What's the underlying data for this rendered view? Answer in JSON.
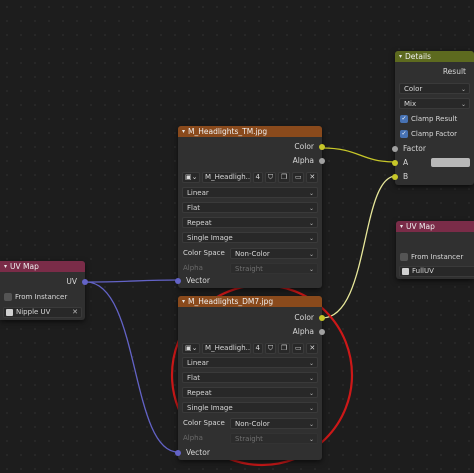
{
  "nodes": {
    "details": {
      "title": "Details",
      "out_result": "Result",
      "dd_color": "Color",
      "dd_mix": "Mix",
      "clamp_result": "Clamp Result",
      "clamp_factor": "Clamp Factor",
      "in_factor": "Factor",
      "in_a": "A",
      "in_b": "B"
    },
    "image_tm": {
      "title": "M_Headlights_TM.jpg",
      "out_color": "Color",
      "out_alpha": "Alpha",
      "image_name": "M_Headligh...",
      "users": "4",
      "interpolation": "Linear",
      "projection": "Flat",
      "extension": "Repeat",
      "source": "Single Image",
      "color_space_label": "Color Space",
      "color_space": "Non-Color",
      "alpha_label": "Alpha",
      "alpha": "Straight",
      "in_vector": "Vector"
    },
    "image_dm7": {
      "title": "M_Headlights_DM7.jpg",
      "out_color": "Color",
      "out_alpha": "Alpha",
      "image_name": "M_Headligh...",
      "users": "4",
      "interpolation": "Linear",
      "projection": "Flat",
      "extension": "Repeat",
      "source": "Single Image",
      "color_space_label": "Color Space",
      "color_space": "Non-Color",
      "alpha_label": "Alpha",
      "alpha": "Straight",
      "in_vector": "Vector"
    },
    "uvmap_left": {
      "title": "UV Map",
      "out_uv": "UV",
      "from_instancer": "From Instancer",
      "uv_name": "Nipple UV"
    },
    "uvmap_right": {
      "title": "UV Map",
      "from_instancer": "From Instancer",
      "uv_name": "FullUV"
    }
  },
  "colors": {
    "annotation_circle": "#cc1818",
    "link_color": "#c7c729",
    "link_vector": "#6363c7",
    "link_grey": "#a1a1a1"
  }
}
